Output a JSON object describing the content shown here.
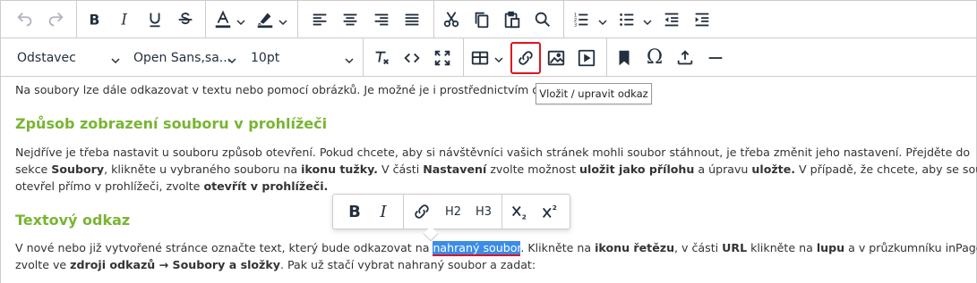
{
  "toolbar": {
    "format_select": "Odstavec",
    "font_select": "Open Sans,sa...",
    "size_select": "10pt",
    "tooltip_link": "Vložit / upravit odkaz",
    "omega": "Ω"
  },
  "content": {
    "p1": "Na soubory lze dále odkazovat v textu nebo pomocí obrázků. Je možné je i prostřednictvím odka",
    "h1": "Způsob zobrazení souboru v prohlížeči",
    "p2_l1": "Nejdříve je třeba nastavit u souboru způsob otevření. Pokud chcete, aby si návštěvníci vašich stránek mohli soubor stáhnout, je třeba změnit jeho nastavení. Přejděte do",
    "p2_l2_a": "sekce ",
    "p2_l2_b": "Soubory",
    "p2_l2_c": ", klikněte u vybraného souboru na ",
    "p2_l2_d": "ikonu tužky.",
    "p2_l2_e": " V části ",
    "p2_l2_f": "Nastavení",
    "p2_l2_g": " zvolte možnost ",
    "p2_l2_h": "uložit jako přílohu",
    "p2_l2_i": " a úpravu ",
    "p2_l2_j": "uložte.",
    "p2_l2_k": " V případě, že chcete, aby se soubor",
    "p2_l3_a": "otevřel přímo v prohlížeči, zvolte ",
    "p2_l3_b": "otevřít v prohlížeči.",
    "h2": "Textový odkaz",
    "p3_l1_a": "V nové nebo již vytvořené stránce označte text, který bude odkazovat na ",
    "p3_l1_sel": "nahraný soubor",
    "p3_l1_b": ". Klikněte na ",
    "p3_l1_c": "ikonu řetězu",
    "p3_l1_d": ", v části ",
    "p3_l1_e": "URL",
    "p3_l1_f": " klikněte na ",
    "p3_l1_g": "lupu",
    "p3_l1_h": " a v průzkumníku inPage",
    "p3_l2_a": "zvolte ve ",
    "p3_l2_b": "zdroji odkazů → Soubory a složky",
    "p3_l2_c": ".  Pak už stačí vybrat nahraný soubor a zadat:"
  },
  "quickbar": {
    "bold": "B",
    "italic": "I",
    "h2": "H2",
    "h3": "H3"
  },
  "colors": {
    "heading": "#78b531",
    "selection": "#3a8ce8",
    "highlight_border": "#e0141e"
  }
}
